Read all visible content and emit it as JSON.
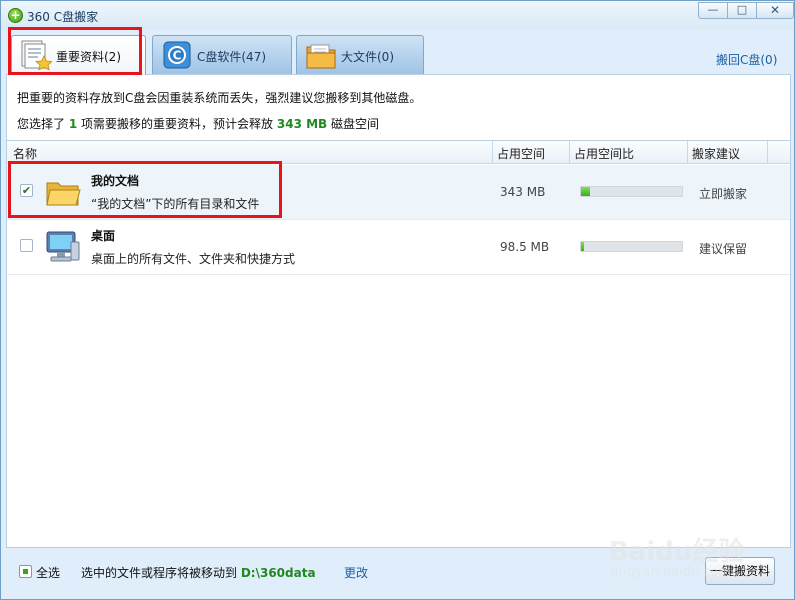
{
  "window": {
    "title": "360 C盘搬家",
    "min_glyph": "—",
    "max_glyph": "□",
    "close_glyph": "✕"
  },
  "tabs": [
    {
      "label": "重要资料(2)",
      "icon": "documents-star-icon",
      "active": true
    },
    {
      "label": "C盘软件(47)",
      "icon": "c-drive-app-icon",
      "active": false
    },
    {
      "label": "大文件(0)",
      "icon": "large-files-folder-icon",
      "active": false
    }
  ],
  "restore_link": "搬回C盘(0)",
  "info": {
    "line1": "把重要的资料存放到C盘会因重装系统而丢失，强烈建议您搬移到其他磁盘。",
    "line2_pre": "您选择了",
    "selected_count": "1",
    "line2_mid": "项需要搬移的重要资料，预计会释放",
    "release_size": "343 MB",
    "line2_post": "磁盘空间"
  },
  "table": {
    "headers": {
      "name": "名称",
      "size": "占用空间",
      "ratio": "占用空间比",
      "advice": "搬家建议"
    },
    "rows": [
      {
        "checked": true,
        "icon": "folder-icon",
        "title": "我的文档",
        "desc": "“我的文档”下的所有目录和文件",
        "size": "343 MB",
        "ratio": 0.09,
        "advice": "立即搬家"
      },
      {
        "checked": false,
        "icon": "desktop-computer-icon",
        "title": "桌面",
        "desc": "桌面上的所有文件、文件夹和快捷方式",
        "size": "98.5 MB",
        "ratio": 0.03,
        "advice": "建议保留"
      }
    ]
  },
  "footer": {
    "select_all": "全选",
    "move_text": "选中的文件或程序将被移动到",
    "path": "D:\\360data",
    "change": "更改",
    "button": "一键搬资料"
  },
  "watermark": {
    "line1": "Baidu经验",
    "line2": "jingyan.baidu.com"
  },
  "colors": {
    "accent_green": "#1f8a1f",
    "link_blue": "#1b5fa8",
    "annotation_red": "#e8141b",
    "window_bg": "#dfeefa"
  }
}
